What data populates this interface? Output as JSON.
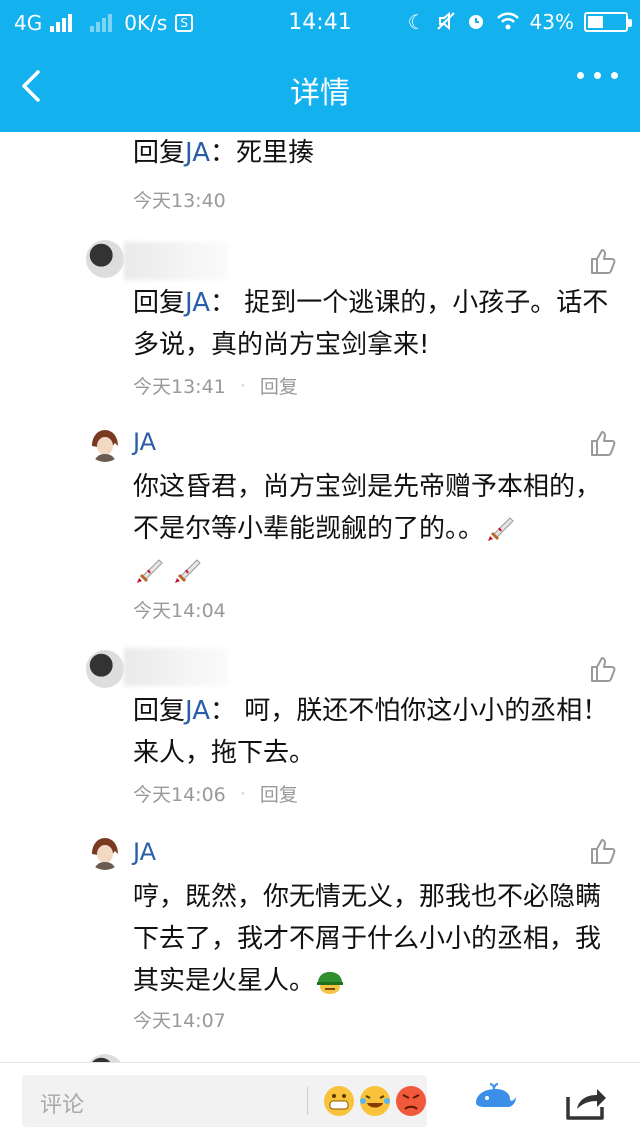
{
  "status_bar": {
    "network": "4G",
    "speed": "0K/s",
    "time": "14:41",
    "battery": "43%",
    "battery_level": 0.43
  },
  "nav": {
    "title": "详情"
  },
  "comments": [
    {
      "reply_prefix": "回复",
      "reply_target": "JA",
      "reply_colon": "：",
      "body": "死里揍",
      "time": "今天13:40"
    },
    {
      "reply_prefix": "回复",
      "reply_target": "JA",
      "reply_colon": "：",
      "body": "捉到一个逃课的，小孩子。话不多说，真的尚方宝剑拿来!",
      "time": "今天13:41",
      "reply_label": "回复"
    },
    {
      "username": "JA",
      "body": "你这昏君，尚方宝剑是先帝赠予本相的，不是尔等小辈能觊觎的了的。。",
      "time": "今天14:04"
    },
    {
      "reply_prefix": "回复",
      "reply_target": "JA",
      "reply_colon": "：",
      "body": "呵，朕还不怕你这小小的丞相！来人，拖下去。",
      "time": "今天14:06",
      "reply_label": "回复"
    },
    {
      "username": "JA",
      "body": "哼，既然，你无情无义，那我也不必隐瞒下去了，我才不屑于什么小小的丞相，我其实是火星人。",
      "time": "今天14:07"
    }
  ],
  "comment_box": {
    "placeholder": "评论"
  },
  "icons": {
    "back": "chevron-left-icon",
    "more": "more-dots-icon",
    "like": "thumbs-up-icon",
    "sword": "sword-emoji-icon",
    "helmet": "green-helmet-emoji-icon",
    "whale": "whale-icon",
    "share": "share-icon"
  },
  "colors": {
    "header": "#13b2ef",
    "username": "#2a5ea8",
    "meta": "#999999"
  }
}
